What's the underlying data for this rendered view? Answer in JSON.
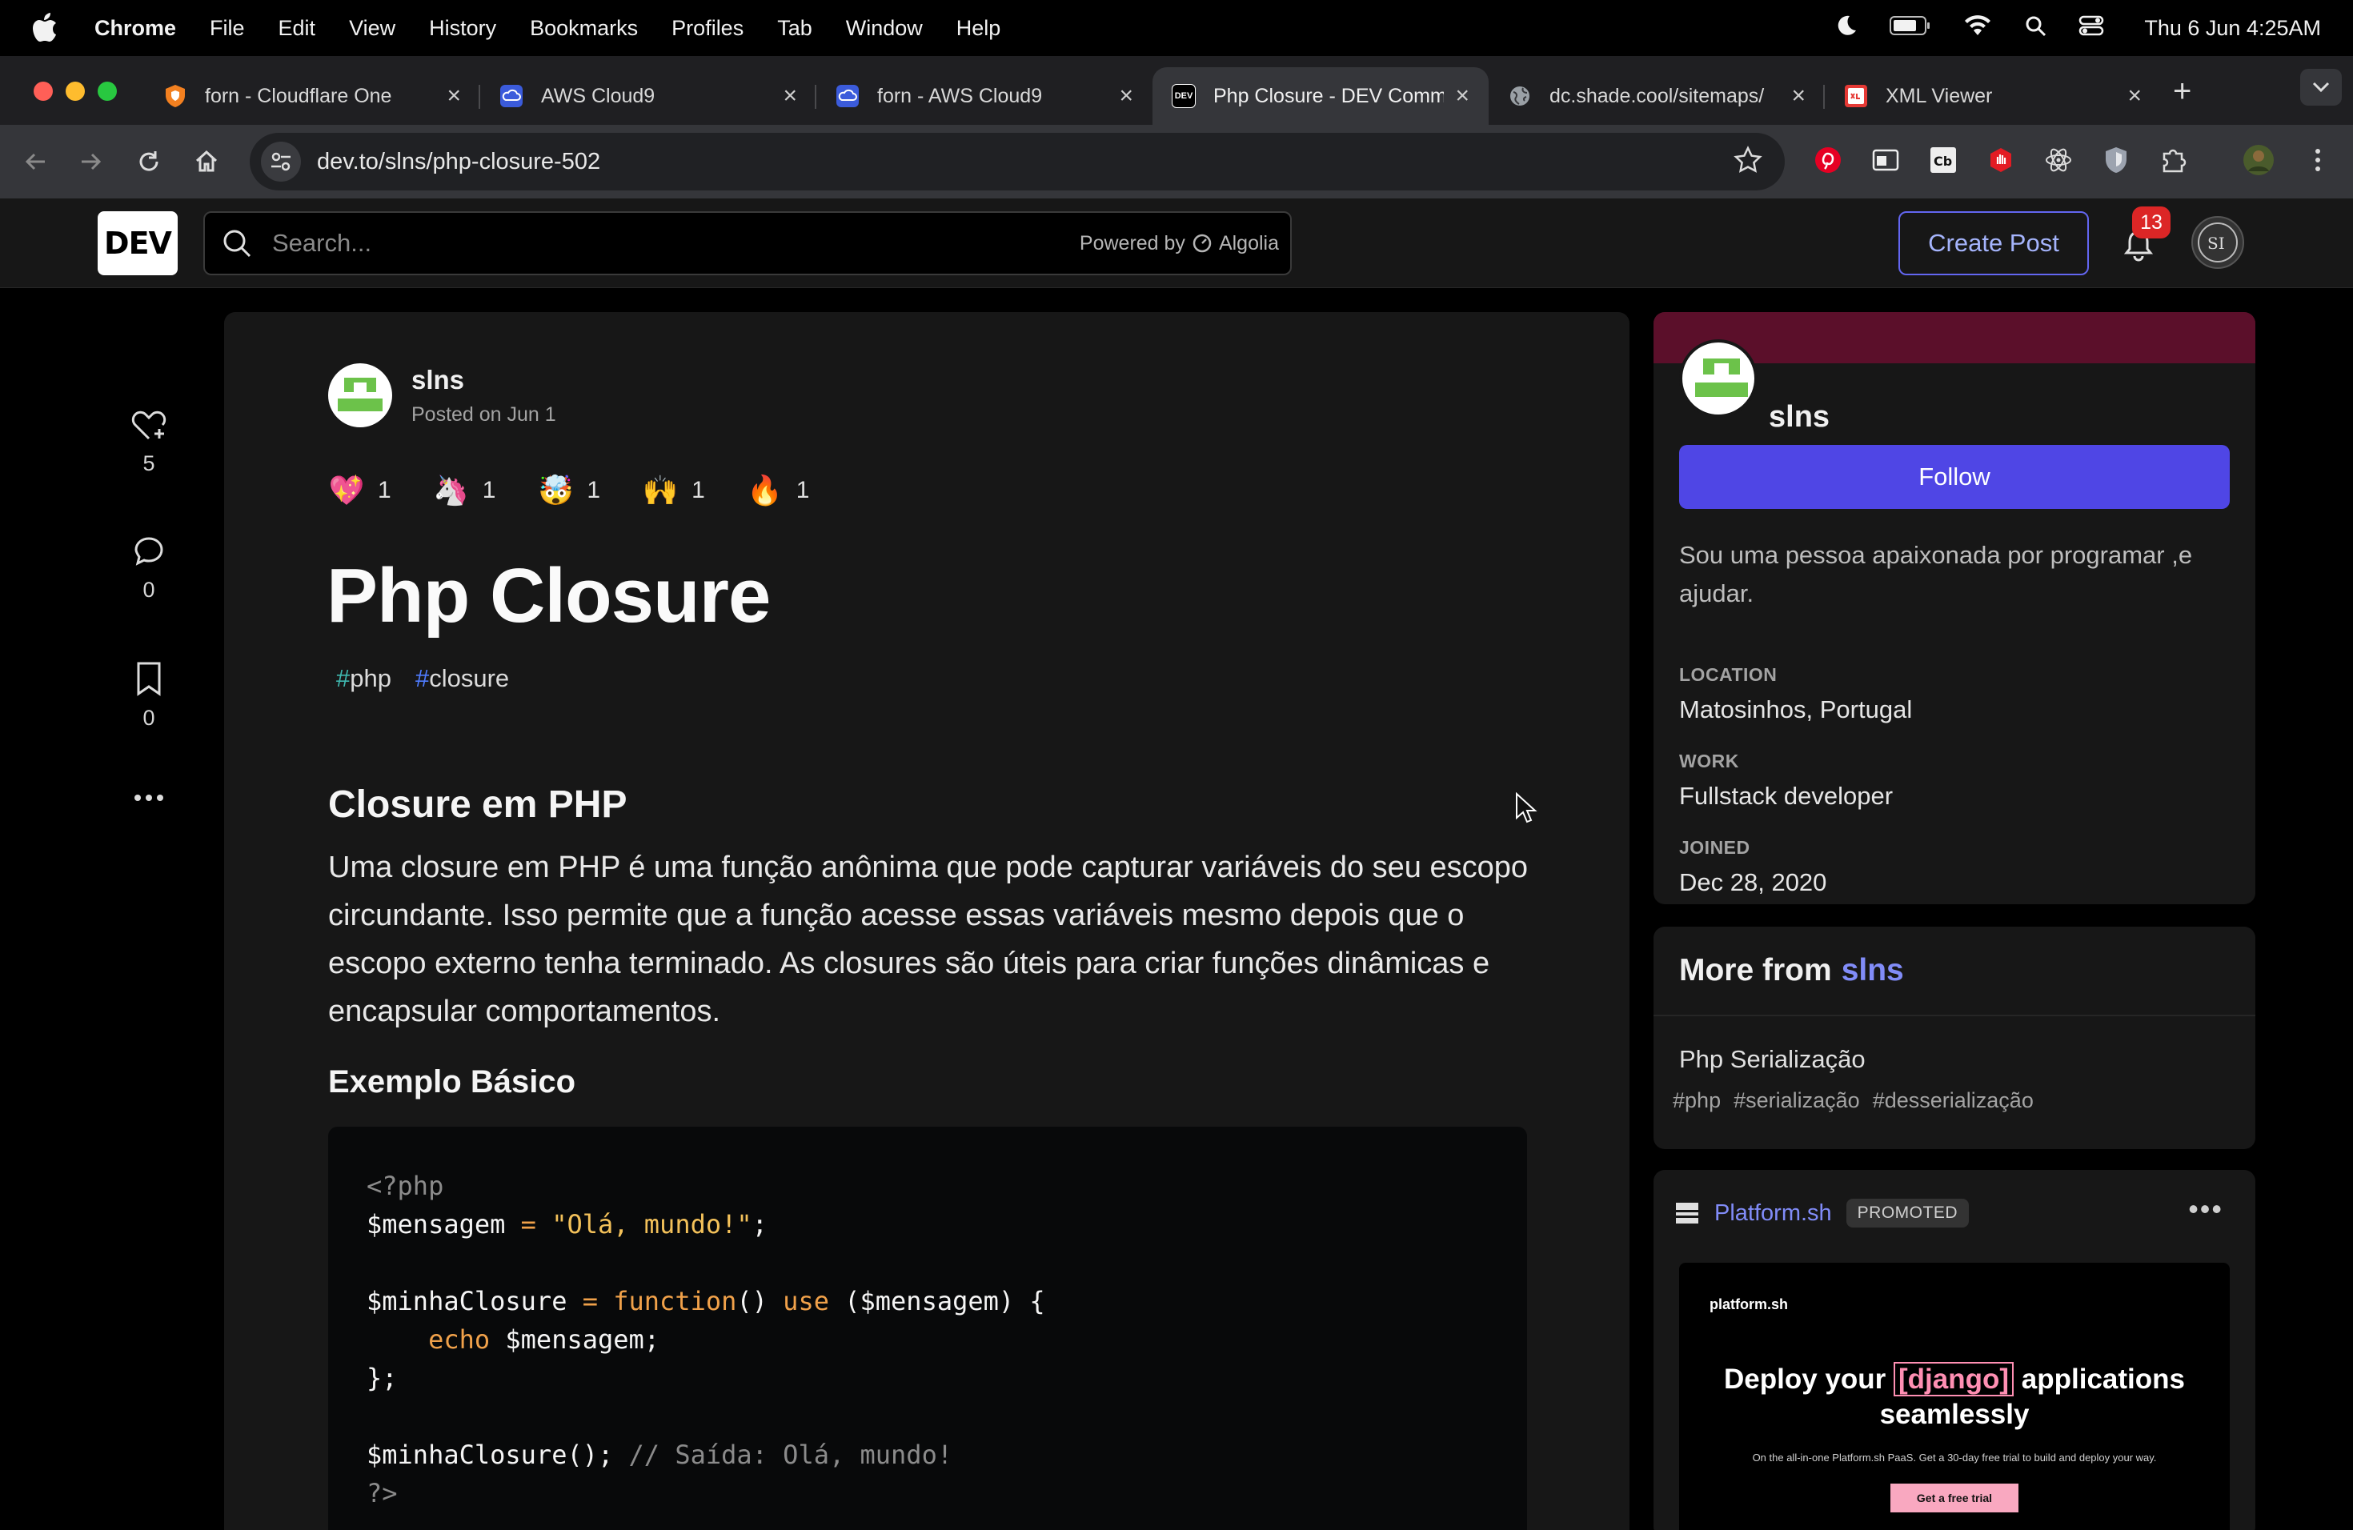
{
  "menubar": {
    "app": "Chrome",
    "items": [
      "File",
      "Edit",
      "View",
      "History",
      "Bookmarks",
      "Profiles",
      "Tab",
      "Window",
      "Help"
    ],
    "clock": "Thu 6 Jun  4:25AM"
  },
  "tabs": [
    {
      "title": "forn - Cloudflare One",
      "favicon_color": "#f38020",
      "favicon": "cloudflare-icon"
    },
    {
      "title": "AWS Cloud9",
      "favicon_color": "#4a6cf7",
      "favicon": "cloud9-icon"
    },
    {
      "title": "forn - AWS Cloud9",
      "favicon_color": "#4a6cf7",
      "favicon": "cloud9-icon"
    },
    {
      "title": "Php Closure - DEV Comm",
      "favicon_color": "#ffffff",
      "favicon": "dev-icon",
      "favicon_text": "DEV"
    },
    {
      "title": "dc.shade.cool/sitemaps/",
      "favicon_color": "#9aa0a6",
      "favicon": "globe-icon"
    },
    {
      "title": "XML Viewer",
      "favicon_color": "#e53935",
      "favicon": "xml-viewer-icon"
    }
  ],
  "address": {
    "url": "dev.to/slns/php-closure-502"
  },
  "dev": {
    "logo": "DEV",
    "search_placeholder": "Search...",
    "powered_by": "Powered by",
    "algolia": "Algolia",
    "create_post": "Create Post",
    "notifications": "13"
  },
  "sidebar_reactions": {
    "likes": "5",
    "comments": "0",
    "bookmarks": "0"
  },
  "article": {
    "author": "slns",
    "posted": "Posted on Jun 1",
    "reactions": [
      {
        "icon": "sparkle-heart-icon",
        "glyph": "💖",
        "count": "1"
      },
      {
        "icon": "unicorn-icon",
        "glyph": "🦄",
        "count": "1"
      },
      {
        "icon": "exploding-head-icon",
        "glyph": "🤯",
        "count": "1"
      },
      {
        "icon": "raised-hands-icon",
        "glyph": "🙌",
        "count": "1"
      },
      {
        "icon": "fire-icon",
        "glyph": "🔥",
        "count": "1"
      }
    ],
    "title": "Php Closure",
    "tags": [
      {
        "hash": "#",
        "name": "php"
      },
      {
        "hash": "#",
        "name": "closure"
      }
    ],
    "heading": "Closure em PHP",
    "paragraph": "Uma closure em PHP é uma função anônima que pode capturar variáveis do seu escopo circundante. Isso permite que a função acesse essas variáveis mesmo depois que o escopo externo tenha terminado. As closures são úteis para criar funções dinâmicas e encapsular comportamentos.",
    "subheading": "Exemplo Básico",
    "code": {
      "l1": "<?php",
      "l2_var": "$mensagem",
      "l2_op": "=",
      "l2_str": "\"Olá, mundo!\"",
      "l2_end": ";",
      "l4_var": "$minhaClosure",
      "l4_op": "=",
      "l4_fn": "function",
      "l4_mid": "()",
      "l4_use": "use",
      "l4_end": "($mensagem) {",
      "l5_kw": "echo",
      "l5_rest": "$mensagem;",
      "l6": "};",
      "l8_call": "$minhaClosure();",
      "l8_cmt": "// Saída: Olá, mundo!",
      "l9": "?>"
    }
  },
  "profile": {
    "name": "slns",
    "follow": "Follow",
    "bio": "Sou uma pessoa apaixonada por programar ,e ajudar.",
    "location_label": "LOCATION",
    "location": "Matosinhos, Portugal",
    "work_label": "WORK",
    "work": "Fullstack developer",
    "joined_label": "JOINED",
    "joined": "Dec 28, 2020"
  },
  "more_from": {
    "label": "More from",
    "who": "slns",
    "post_title": "Php Serialização",
    "tags": [
      "php",
      "serialização",
      "desserialização"
    ]
  },
  "promo": {
    "brand": "Platform.sh",
    "badge": "PROMOTED",
    "banner_logo": "platform.sh",
    "headline_pre": "Deploy your",
    "headline_tag": "[django]",
    "headline_post": "applications seamlessly",
    "subtext": "On the all-in-one Platform.sh PaaS. Get a 30-day free trial to build and deploy your way.",
    "cta": "Get a free trial"
  },
  "colors": {
    "accent": "#4f46e5",
    "profile_band": "#5b0f2a",
    "card": "#171717"
  }
}
